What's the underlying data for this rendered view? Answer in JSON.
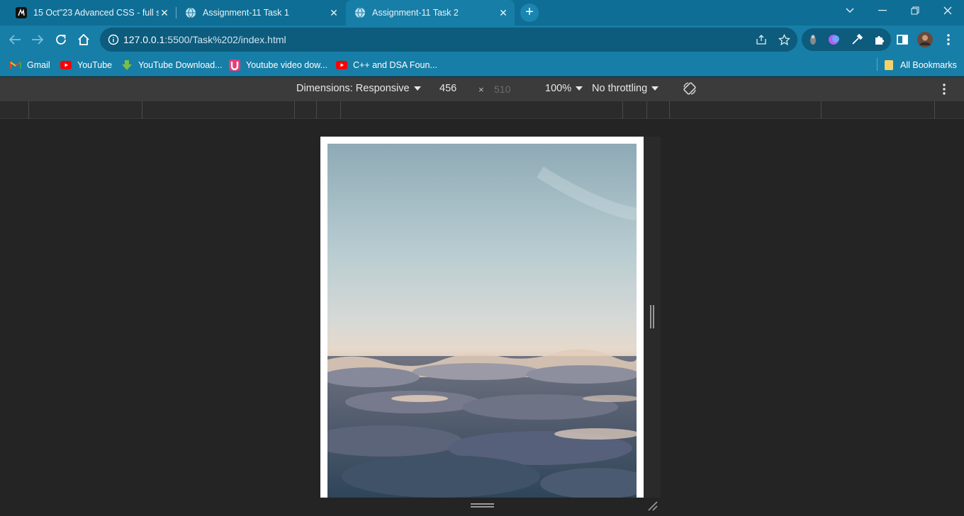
{
  "tabs": [
    {
      "title": "15 Oct\"23 Advanced CSS - full st",
      "icon": "site-favicon-icon",
      "active": false
    },
    {
      "title": "Assignment-11 Task 1",
      "icon": "globe-icon",
      "active": false
    },
    {
      "title": "Assignment-11 Task 2",
      "icon": "globe-icon",
      "active": true
    }
  ],
  "toolbar": {
    "url_host": "127.0.0.1",
    "url_path": ":5500/Task%202/index.html"
  },
  "bookmarks": [
    {
      "label": "Gmail",
      "icon": "gmail-icon"
    },
    {
      "label": "YouTube",
      "icon": "youtube-icon"
    },
    {
      "label": "YouTube Download...",
      "icon": "download-arrow-icon"
    },
    {
      "label": "Youtube video dow...",
      "icon": "u-logo-icon"
    },
    {
      "label": "C++ and DSA Foun...",
      "icon": "youtube-icon"
    }
  ],
  "all_bookmarks": "All Bookmarks",
  "devtools": {
    "dimensions_label": "Dimensions: Responsive",
    "width": "456",
    "separator": "×",
    "height": "510",
    "zoom": "100%",
    "throttling": "No throttling"
  },
  "colors": {
    "tabstrip": "#0f6e95",
    "toolbar": "#177ea7",
    "devtools_bg": "#242424"
  }
}
